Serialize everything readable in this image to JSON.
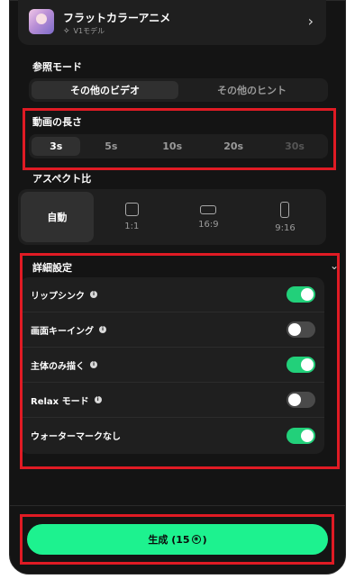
{
  "model": {
    "name": "フラットカラーアニメ",
    "version": "V1モデル",
    "icons": {
      "thumbnail": "anime-avatar-thumbnail",
      "sparkle": "sparkle-icon",
      "chevron": "chevron-right-icon"
    }
  },
  "reference_mode": {
    "label": "参照モード",
    "options": [
      "その他のビデオ",
      "その他のヒント"
    ],
    "selected": "その他のビデオ"
  },
  "duration": {
    "label": "動画の長さ",
    "options": [
      "3s",
      "5s",
      "10s",
      "20s",
      "30s"
    ],
    "selected": "3s",
    "disabled": [
      "30s"
    ]
  },
  "aspect_ratio": {
    "label": "アスペクト比",
    "options": [
      "自動",
      "1:1",
      "16:9",
      "9:16"
    ],
    "selected": "自動"
  },
  "advanced": {
    "label": "詳細設定",
    "toggles": [
      {
        "label": "リップシンク",
        "info": true,
        "on": true
      },
      {
        "label": "画面キーイング",
        "info": true,
        "on": false
      },
      {
        "label": "主体のみ描く",
        "info": true,
        "on": true
      },
      {
        "label": "Relax モード",
        "info": true,
        "on": false
      },
      {
        "label": "ウォーターマークなし",
        "info": false,
        "on": true
      }
    ]
  },
  "generate": {
    "label": "生成 (15",
    "cost": "15",
    "suffix": ")"
  },
  "colors": {
    "accent": "#1df28f",
    "toggle_on": "#22d07a",
    "highlight": "#e01b24",
    "panel": "#141414"
  }
}
